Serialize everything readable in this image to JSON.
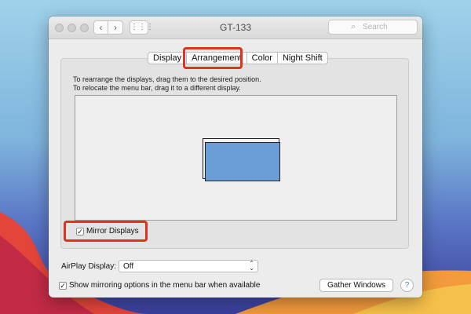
{
  "window": {
    "title": "GT-133",
    "search_placeholder": "Search",
    "nav": {
      "back": "‹",
      "forward": "›",
      "grid": "⋮⋮⋮"
    }
  },
  "tabs": [
    {
      "label": "Display",
      "selected": false
    },
    {
      "label": "Arrangement",
      "selected": true
    },
    {
      "label": "Color",
      "selected": false
    },
    {
      "label": "Night Shift",
      "selected": false
    }
  ],
  "instructions": {
    "line1": "To rearrange the displays, drag them to the desired position.",
    "line2": "To relocate the menu bar, drag it to a different display."
  },
  "mirror_displays": {
    "label": "Mirror Displays",
    "checked": true
  },
  "airplay": {
    "label": "AirPlay Display:",
    "value": "Off"
  },
  "show_mirroring": {
    "label": "Show mirroring options in the menu bar when available",
    "checked": true
  },
  "buttons": {
    "gather_windows": "Gather Windows",
    "help": "?"
  },
  "colors": {
    "highlight": "#e0321e",
    "display": "#6b9ed6"
  },
  "icons": {
    "checkmark": "✓",
    "popup_arrows": "⌃⌄"
  }
}
